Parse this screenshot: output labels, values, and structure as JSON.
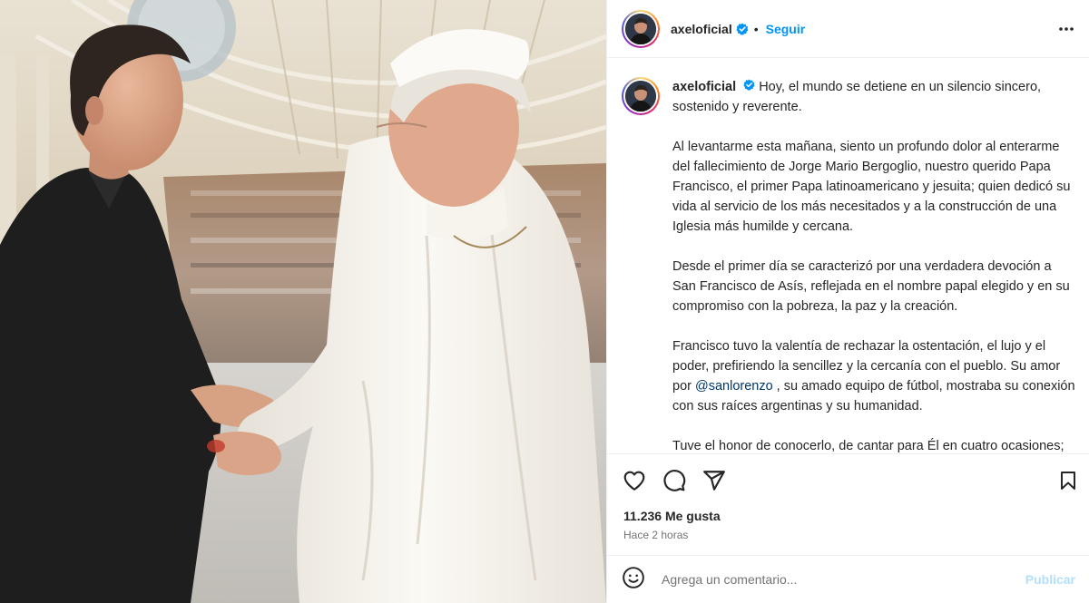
{
  "post": {
    "username": "axeloficial",
    "follow_label": "Seguir",
    "separator": "•",
    "more_icon": "more-horizontal-icon",
    "verified_icon": "verified-badge-icon"
  },
  "caption": {
    "username": "axeloficial",
    "p1": "Hoy, el mundo se detiene en un silencio sincero, sostenido y reverente.",
    "p2": "Al levantarme esta mañana, siento un profundo dolor al enterarme del fallecimiento de Jorge Mario Bergoglio, nuestro querido Papa Francisco, el primer Papa latinoamericano y jesuita; quien dedicó su vida al servicio de los más necesitados y a la construcción de una Iglesia más humilde y cercana.",
    "p3": "Desde el primer día se caracterizó por una verdadera devoción a San Francisco de Asís, reflejada en el nombre papal elegido y en su compromiso con la pobreza, la paz y la creación.",
    "p4_before": "Francisco tuvo la valentía de rechazar la ostentación, el lujo y el poder, prefiriendo la sencillez y la cercanía con el pueblo. Su amor por ",
    "p4_mention": "@sanlorenzo",
    "p4_after": " , su amado equipo de fútbol, mostraba su conexión con sus raíces argentinas y su humanidad.",
    "p5": "Tuve el honor de conocerlo, de cantar para Él en cuatro ocasiones; en su asunción como Papa, en la Jornada Mundial de la Juventud en Río de Janeiro, en La Jornada Mundial de la Juventud en Panamá"
  },
  "actions": {
    "like_icon": "heart-icon",
    "comment_icon": "comment-icon",
    "share_icon": "share-icon",
    "save_icon": "bookmark-icon"
  },
  "likes_text": "11.236 Me gusta",
  "time_text": "Hace 2 horas",
  "comment": {
    "emoji_icon": "emoji-icon",
    "placeholder": "Agrega un comentario...",
    "value": "",
    "publish_label": "Publicar"
  },
  "colors": {
    "accent": "#0095f6",
    "verified": "#0095f6",
    "publish_disabled": "#b2dffc",
    "secondary_text": "#737373"
  }
}
